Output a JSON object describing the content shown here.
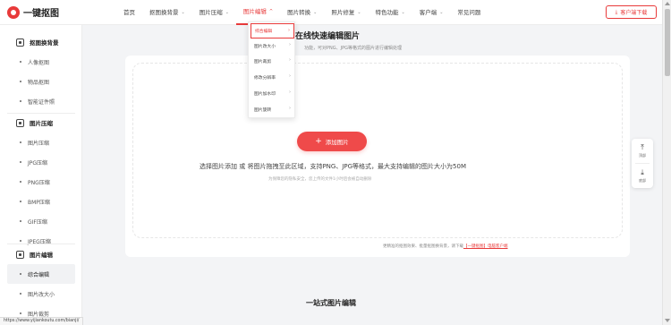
{
  "brand": {
    "name": "一键抠图"
  },
  "nav": [
    {
      "label": "首页",
      "chevron": false
    },
    {
      "label": "抠图换背景",
      "chevron": true
    },
    {
      "label": "图片压缩",
      "chevron": true
    },
    {
      "label": "图片编辑",
      "chevron": true
    },
    {
      "label": "图片转换",
      "chevron": true
    },
    {
      "label": "照片修复",
      "chevron": true
    },
    {
      "label": "特色功能",
      "chevron": true
    },
    {
      "label": "客户端",
      "chevron": true
    },
    {
      "label": "常见问题",
      "chevron": false
    }
  ],
  "download_button": {
    "label": "客户端下载"
  },
  "dropdown": {
    "items": [
      "综合编辑",
      "图片改大小",
      "图片裁剪",
      "修改分辨率",
      "图片加水印",
      "图片旋转"
    ],
    "current": "综合编辑"
  },
  "sidebar": {
    "groups": [
      {
        "title": "抠图换背景",
        "items": [
          "人像抠图",
          "物品抠图",
          "智能证件照"
        ]
      },
      {
        "title": "图片压缩",
        "items": [
          "图片压缩",
          "JPG压缩",
          "PNG压缩",
          "BMP压缩",
          "GIF压缩",
          "JPEG压缩"
        ]
      },
      {
        "title": "图片编辑",
        "items": [
          "综合编辑",
          "图片改大小",
          "图片裁剪"
        ]
      }
    ],
    "selected": "综合编辑"
  },
  "main": {
    "title": "在线快速编辑图片",
    "subtitle": "功能，可对PNG、JPG等格式的图片进行编辑处理",
    "add_button": "添加图片",
    "upload_hint": "选择图片添加 或 将图片拖拽至此区域，支持PNG、JPG等格式，最大支持编辑的图片大小为50M",
    "privacy_note": "为保障您的隐私安全，您上传的文件1小时后会被自动删除",
    "promo_text": "更精准的抠图效果、批量抠图换背景，请下载",
    "promo_link": "【一键抠图】电脑客户端",
    "section_title": "一站式图片编辑"
  },
  "float": {
    "top_label": "顶部",
    "bottom_label": "底部"
  },
  "status_url": "https://www.yijiankoutu.com/bianji/",
  "colors": {
    "accent": "#e83a3a",
    "add_button": "#ef4a4a"
  }
}
